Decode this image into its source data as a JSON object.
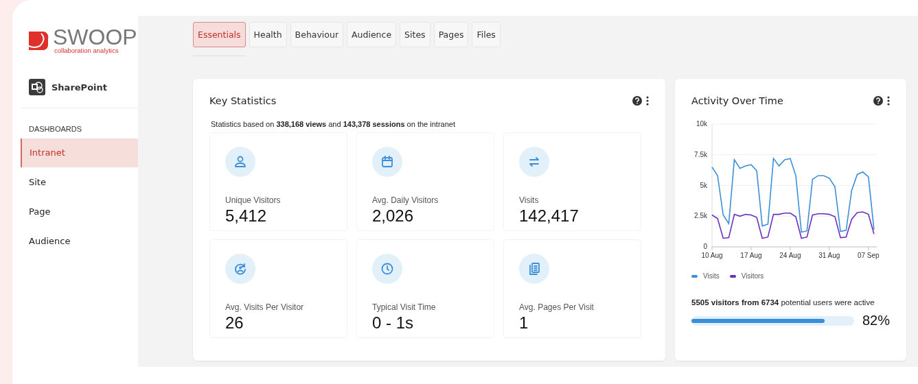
{
  "brand": {
    "name": "SWOOP",
    "tagline": "collaboration analytics"
  },
  "product": {
    "name": "SharePoint"
  },
  "sidebar": {
    "heading": "DASHBOARDS",
    "items": [
      {
        "label": "Intranet",
        "selected": true
      },
      {
        "label": "Site",
        "selected": false
      },
      {
        "label": "Page",
        "selected": false
      },
      {
        "label": "Audience",
        "selected": false
      }
    ]
  },
  "tabs": [
    {
      "label": "Essentials",
      "selected": true
    },
    {
      "label": "Health",
      "selected": false
    },
    {
      "label": "Behaviour",
      "selected": false
    },
    {
      "label": "Audience",
      "selected": false
    },
    {
      "label": "Sites",
      "selected": false
    },
    {
      "label": "Pages",
      "selected": false
    },
    {
      "label": "Files",
      "selected": false
    }
  ],
  "key_statistics": {
    "title": "Key Statistics",
    "subtitle": "Statistics based on **338,168 views** and **143,378 sessions** on the intranet",
    "stats": [
      {
        "kind": "person",
        "label": "Unique Visitors",
        "value": "5,412"
      },
      {
        "kind": "calendar",
        "label": "Avg. Daily Visitors",
        "value": "2,026"
      },
      {
        "kind": "arrows",
        "label": "Visits",
        "value": "142,417"
      },
      {
        "kind": "returning",
        "label": "Avg. Visits Per Visitor",
        "value": "26"
      },
      {
        "kind": "clock",
        "label": "Typical Visit Time",
        "value": "0 - 1s"
      },
      {
        "kind": "pages",
        "label": "Avg. Pages Per Visit",
        "value": "1"
      }
    ]
  },
  "activity": {
    "title": "Activity Over Time",
    "chart_data": {
      "type": "line",
      "categories": [
        "10 Aug",
        null,
        null,
        null,
        null,
        null,
        null,
        "17 Aug",
        null,
        null,
        null,
        null,
        null,
        null,
        "24 Aug",
        null,
        null,
        null,
        null,
        null,
        null,
        "31 Aug",
        null,
        null,
        null,
        null,
        null,
        null,
        "07 Sep",
        null
      ],
      "series": [
        {
          "name": "Visits",
          "color": "#3b8fd9",
          "values": [
            6500,
            5800,
            2600,
            1900,
            7100,
            6400,
            6600,
            6700,
            6200,
            1700,
            1850,
            7200,
            6600,
            7100,
            7200,
            5800,
            1200,
            1300,
            5500,
            5800,
            5800,
            5600,
            4900,
            1250,
            1350,
            4600,
            5900,
            6100,
            5700,
            1400
          ]
        },
        {
          "name": "Visitors",
          "color": "#6a2fc0",
          "values": [
            2600,
            2300,
            700,
            750,
            2650,
            2500,
            2650,
            2600,
            2400,
            700,
            800,
            2650,
            2650,
            2750,
            2750,
            2450,
            700,
            800,
            2600,
            2700,
            2700,
            2650,
            2450,
            750,
            800,
            2250,
            2800,
            2850,
            2650,
            1050
          ]
        }
      ],
      "ylim": [
        0,
        10000
      ],
      "grid": true,
      "yticks": [
        {
          "value": 0,
          "label": "0"
        },
        {
          "value": 2500,
          "label": "2.5k"
        },
        {
          "value": 5000,
          "label": "5k"
        },
        {
          "value": 7500,
          "label": "7.5k"
        },
        {
          "value": 10000,
          "label": "10k"
        }
      ]
    },
    "summary": "**5505 visitors from 6734** potential users were active",
    "progress": {
      "level": 0.82,
      "reading": "82%"
    }
  }
}
